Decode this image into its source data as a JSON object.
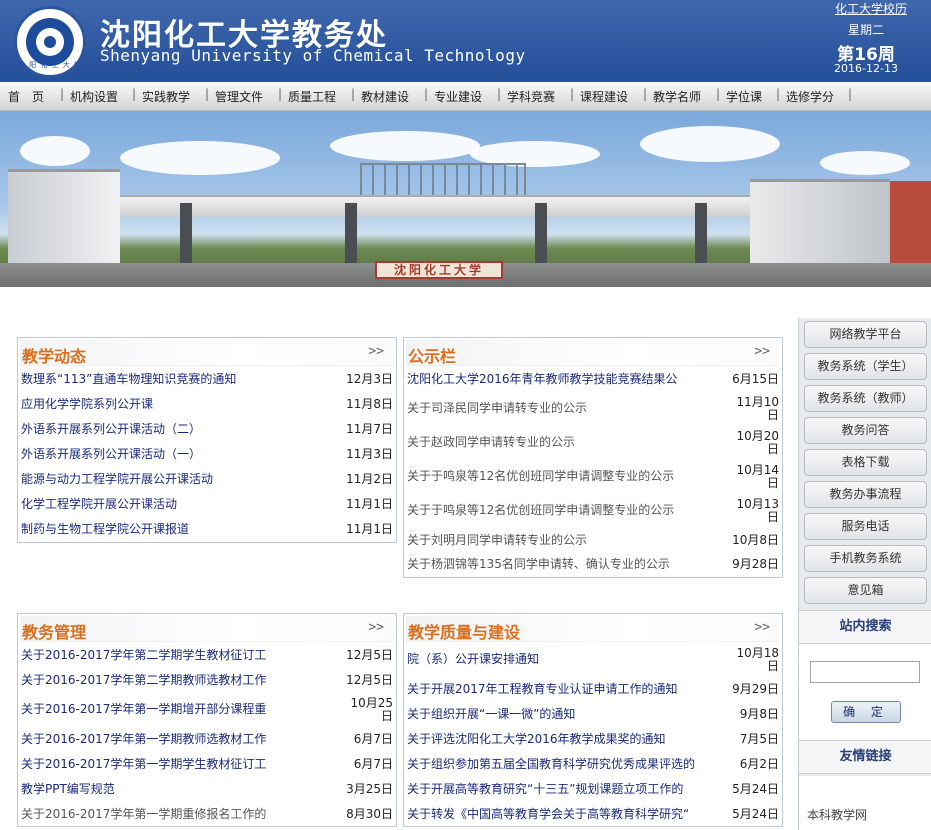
{
  "header": {
    "title": "沈阳化工大学教务处",
    "subtitle": "Shenyang University of Chemical Technology",
    "logo_text": "沈 阳 化 工 大 学",
    "history_link": "化工大学校历",
    "weekday": "星期二",
    "week": "第16周",
    "date": "2016-12-13"
  },
  "nav": {
    "items": [
      "首　页",
      "机构设置",
      "实践教学",
      "管理文件",
      "质量工程",
      "教材建设",
      "专业建设",
      "学科竞赛",
      "课程建设",
      "教学名师",
      "学位课",
      "选修学分"
    ]
  },
  "banner": {
    "sign_text": "沈阳化工大学"
  },
  "panels": {
    "more": ">>",
    "teaching_news": {
      "title": "教学动态",
      "items": [
        {
          "text": "数理系“113”直通车物理知识竞赛的通知",
          "date": "12月3日"
        },
        {
          "text": "应用化学学院系列公开课",
          "date": "11月8日"
        },
        {
          "text": "外语系开展系列公开课活动（二）",
          "date": "11月7日"
        },
        {
          "text": "外语系开展系列公开课活动（一）",
          "date": "11月3日"
        },
        {
          "text": "能源与动力工程学院开展公开课活动",
          "date": "11月2日"
        },
        {
          "text": "化学工程学院开展公开课活动",
          "date": "11月1日"
        },
        {
          "text": "制药与生物工程学院公开课报道",
          "date": "11月1日"
        }
      ]
    },
    "bulletin": {
      "title": "公示栏",
      "items": [
        {
          "text": "沈阳化工大学2016年青年教师教学技能竞赛结果公",
          "date": "6月15日"
        },
        {
          "text": "关于司泽民同学申请转专业的公示",
          "date": "11月10日"
        },
        {
          "text": "关于赵政同学申请转专业的公示",
          "date": "10月20日"
        },
        {
          "text": "关于于鸣泉等12名优创班同学申请调整专业的公示",
          "date": "10月14日"
        },
        {
          "text": "关于于鸣泉等12名优创班同学申请调整专业的公示",
          "date": "10月13日"
        },
        {
          "text": "关于刘明月同学申请转专业的公示",
          "date": "10月8日"
        },
        {
          "text": "关于杨泗锦等135名同学申请转、确认专业的公示",
          "date": "9月28日"
        }
      ]
    },
    "academic_admin": {
      "title": "教务管理",
      "items": [
        {
          "text": "关于2016-2017学年第二学期学生教材征订工",
          "date": "12月5日"
        },
        {
          "text": "关于2016-2017学年第二学期教师选教材工作",
          "date": "12月5日"
        },
        {
          "text": "关于2016-2017学年第一学期增开部分课程重",
          "date": "10月25日"
        },
        {
          "text": "关于2016-2017学年第一学期教师选教材工作",
          "date": "6月7日"
        },
        {
          "text": "关于2016-2017学年第一学期学生教材征订工",
          "date": "6月7日"
        },
        {
          "text": "教学PPT编写规范",
          "date": "3月25日"
        },
        {
          "text": "关于2016-2017学年第一学期重修报名工作的",
          "date": "8月30日"
        }
      ]
    },
    "quality": {
      "title": "教学质量与建设",
      "items": [
        {
          "text": "院（系）公开课安排通知",
          "date": "10月18日"
        },
        {
          "text": "关于开展2017年工程教育专业认证申请工作的通知",
          "date": "9月29日"
        },
        {
          "text": "关于组织开展“一课一微”的通知",
          "date": "9月8日"
        },
        {
          "text": "关于评选沈阳化工大学2016年教学成果奖的通知",
          "date": "7月5日"
        },
        {
          "text": "关于组织参加第五届全国教育科学研究优秀成果评选的",
          "date": "6月2日"
        },
        {
          "text": "关于开展高等教育研究“十三五”规划课题立项工作的",
          "date": "5月24日"
        },
        {
          "text": "关于转发《中国高等教育学会关于高等教育科学研究“",
          "date": "5月24日"
        }
      ]
    }
  },
  "sidebar": {
    "buttons": [
      "网络教学平台",
      "教务系统（学生）",
      "教务系统（教师）",
      "教务问答",
      "表格下载",
      "教务办事流程",
      "服务电话",
      "手机教务系统",
      "意见箱"
    ],
    "search_title": "站内搜索",
    "search_button": "确 定",
    "links_title": "友情链接",
    "link": "本科教学网"
  }
}
